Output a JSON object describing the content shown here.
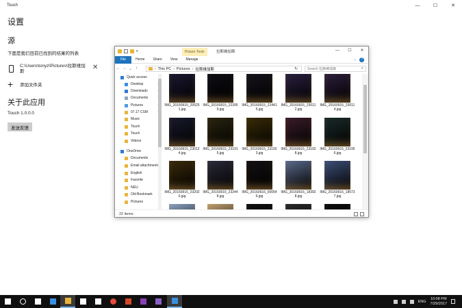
{
  "app": {
    "title": "Touch",
    "window_buttons": [
      "—",
      "☐",
      "✕"
    ]
  },
  "settings": {
    "heading": "设置",
    "source_heading": "源",
    "description": "下面是我们目前已找到的结果的列表",
    "folder_path": "C:\\Users\\tonyz\\Pictures\\拉斯维加斯",
    "remove_symbol": "✕",
    "add_folder_label": "添加文件夹",
    "about_heading": "关于此应用",
    "version": "Touch 1.0.0.0",
    "feedback_button": "发送反馈"
  },
  "explorer": {
    "context_tab": "Picture Tools",
    "title": "拉斯维加斯",
    "window_buttons": [
      "—",
      "☐",
      "✕"
    ],
    "ribbon_tabs": [
      "File",
      "Home",
      "Share",
      "View",
      "Manage"
    ],
    "ribbon_right": [
      "⌄",
      "?"
    ],
    "nav_buttons": [
      "←",
      "→",
      "⌄",
      "↑"
    ],
    "breadcrumb": [
      "This PC",
      "Pictures",
      "拉斯维加斯"
    ],
    "breadcrumb_sep": "›",
    "refresh_symbol": "↻",
    "search_placeholder": "Search 拉斯维加斯",
    "nav_items": [
      {
        "label": "Quick access",
        "pinned": false,
        "icon": "star-icon",
        "color": "#2f7bd6"
      },
      {
        "label": "Desktop",
        "pinned": true,
        "icon": "desktop-icon",
        "color": "#3a8fe0"
      },
      {
        "label": "Downloads",
        "pinned": true,
        "icon": "downloads-icon",
        "color": "#2f7bd6"
      },
      {
        "label": "Documents",
        "pinned": true,
        "icon": "documents-icon",
        "color": "#8aa6c4"
      },
      {
        "label": "Pictures",
        "pinned": true,
        "icon": "pictures-icon",
        "color": "#4d9be0"
      },
      {
        "label": "07.17 CSM",
        "pinned": true,
        "icon": "folder-icon",
        "color": "#e8b53b"
      },
      {
        "label": "Music",
        "pinned": false,
        "icon": "music-icon",
        "color": "#e8b53b"
      },
      {
        "label": "Touch",
        "pinned": false,
        "icon": "folder-icon",
        "color": "#e8b53b"
      },
      {
        "label": "Touch",
        "pinned": false,
        "icon": "folder-icon",
        "color": "#e8b53b"
      },
      {
        "label": "Videos",
        "pinned": false,
        "icon": "videos-icon",
        "color": "#e8b53b"
      },
      {
        "label": "OneDrive",
        "pinned": false,
        "icon": "cloud-icon",
        "color": "#2f7bd6"
      },
      {
        "label": "Documents",
        "pinned": false,
        "icon": "folder-icon",
        "color": "#e8b53b"
      },
      {
        "label": "Email attachments",
        "pinned": false,
        "icon": "folder-icon",
        "color": "#e8b53b"
      },
      {
        "label": "English",
        "pinned": false,
        "icon": "folder-icon",
        "color": "#e8b53b"
      },
      {
        "label": "Favorite",
        "pinned": false,
        "icon": "folder-icon",
        "color": "#e8b53b"
      },
      {
        "label": "NEU",
        "pinned": false,
        "icon": "folder-icon",
        "color": "#e8b53b"
      },
      {
        "label": "Old Bookmark",
        "pinned": false,
        "icon": "folder-icon",
        "color": "#e8b53b"
      },
      {
        "label": "Pictures",
        "pinned": false,
        "icon": "folder-icon",
        "color": "#e8b53b"
      }
    ],
    "pin_symbol": "📌",
    "files": [
      {
        "name": "IMG_20160915_205251.jpg",
        "tone": "#1b1830"
      },
      {
        "name": "IMG_20160915_223959.jpg",
        "tone": "#0d0d14"
      },
      {
        "name": "IMG_20160915_224415.jpg",
        "tone": "#15131c"
      },
      {
        "name": "IMG_20160915_230112.jpg",
        "tone": "#2a2040"
      },
      {
        "name": "IMG_20160915_230114.jpg",
        "tone": "#2b1f3a"
      },
      {
        "name": "IMG_20160915_230124.jpg",
        "tone": "#191a2c"
      },
      {
        "name": "IMG_20160915_231915.jpg",
        "tone": "#2a2410"
      },
      {
        "name": "IMG_20160915_231923.jpg",
        "tone": "#3a2c08"
      },
      {
        "name": "IMG_20160915_231928.jpg",
        "tone": "#3a1c2a"
      },
      {
        "name": "IMG_20160915_231956.jpg",
        "tone": "#1b2a2a"
      },
      {
        "name": "IMG_20160915_232020.jpg",
        "tone": "#3a2a0c"
      },
      {
        "name": "IMG_20160915_232448.jpg",
        "tone": "#2a2a3a"
      },
      {
        "name": "IMG_20160916_000546.jpg",
        "tone": "#141012"
      },
      {
        "name": "IMG_20160916_183928.jpg",
        "tone": "#5a6a8a"
      },
      {
        "name": "IMG_20160916_185737.jpg",
        "tone": "#3d4f78"
      },
      {
        "name": "",
        "tone": "#8aa2c0"
      },
      {
        "name": "",
        "tone": "#c0a070"
      },
      {
        "name": "",
        "tone": "#101010"
      },
      {
        "name": "",
        "tone": "#2a2a2a"
      },
      {
        "name": "",
        "tone": "#0c0c0c"
      }
    ],
    "status": "22 items"
  },
  "taskbar": {
    "apps": [
      {
        "name": "start-icon",
        "color": "#ffffff"
      },
      {
        "name": "cortana-icon",
        "color": "#ffffff"
      },
      {
        "name": "task-view-icon",
        "color": "#ffffff"
      },
      {
        "name": "edge-icon",
        "color": "#3a8fe0"
      },
      {
        "name": "file-explorer-icon",
        "color": "#e8b53b"
      },
      {
        "name": "store-icon",
        "color": "#ffffff"
      },
      {
        "name": "mail-icon",
        "color": "#ffffff"
      },
      {
        "name": "chrome-icon",
        "color": "#e24a3b"
      },
      {
        "name": "powerpoint-icon",
        "color": "#d24726"
      },
      {
        "name": "onenote-icon",
        "color": "#8a3fb6"
      },
      {
        "name": "visual-studio-icon",
        "color": "#8a60c6"
      },
      {
        "name": "touch-app-icon",
        "color": "#3a8fe0"
      }
    ],
    "language": "ENG",
    "time": "10:08 PM",
    "date": "7/29/2017"
  }
}
